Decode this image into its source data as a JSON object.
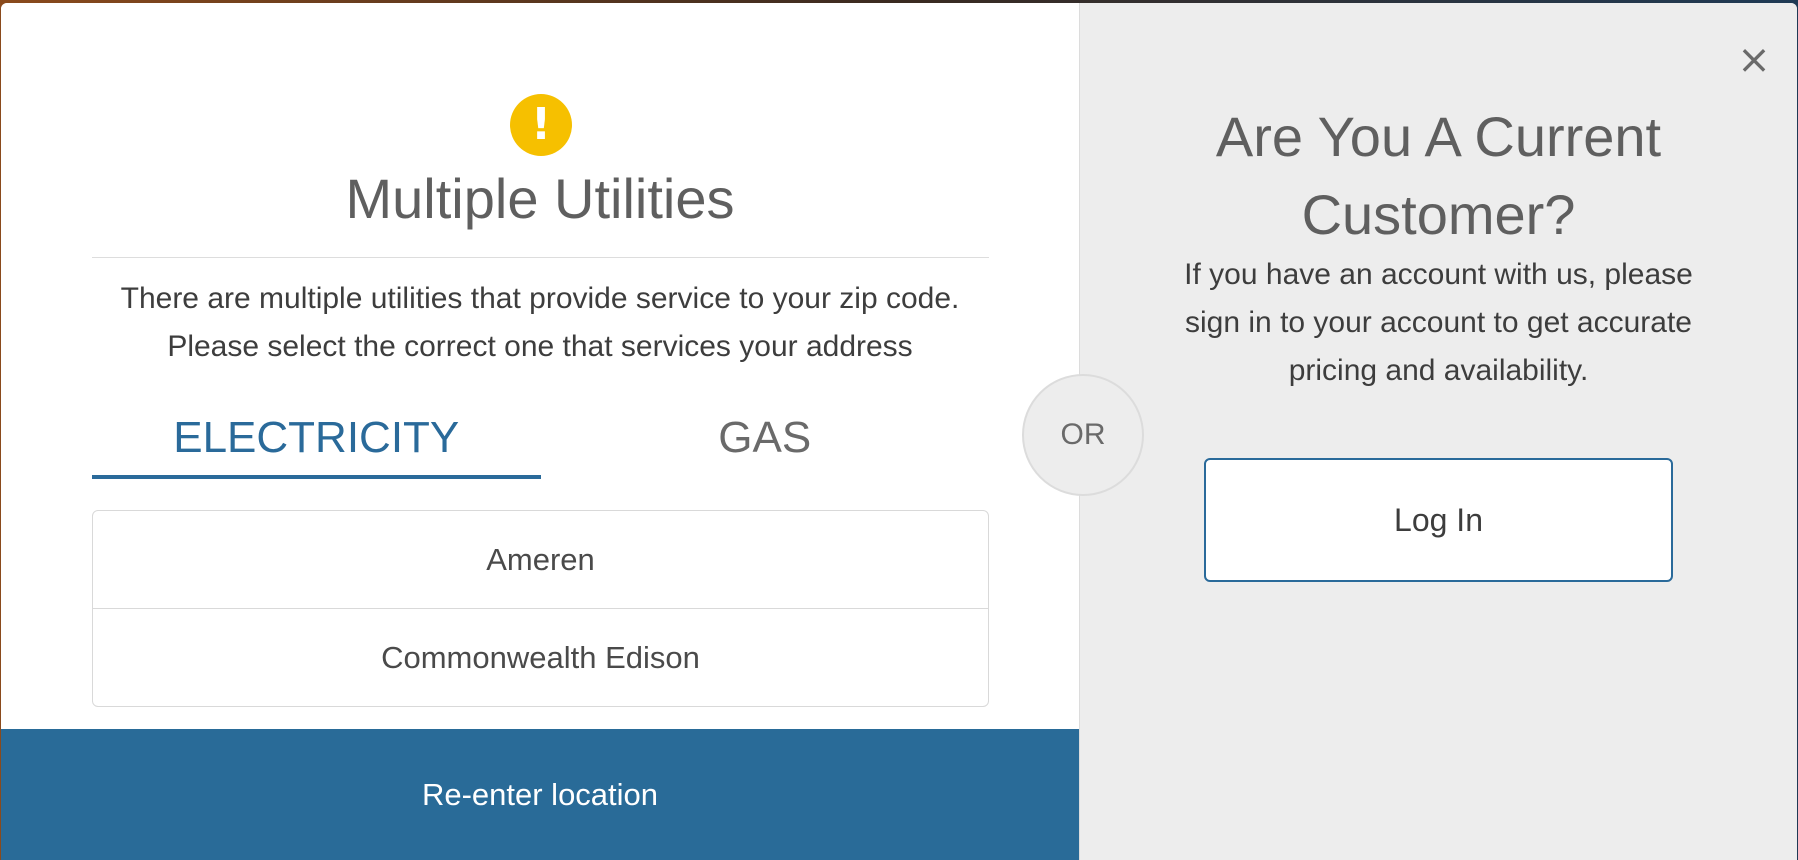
{
  "left_panel": {
    "icon": "exclamation-icon",
    "icon_glyph": "!",
    "title": "Multiple Utilities",
    "description_line1": "There are multiple utilities that provide service to your zip code.",
    "description_line2": "Please select the correct one that services your address",
    "tabs": [
      {
        "label": "ELECTRICITY",
        "active": true
      },
      {
        "label": "GAS",
        "active": false
      }
    ],
    "utilities": [
      "Ameren",
      "Commonwealth Edison"
    ],
    "reenter_label": "Re-enter location"
  },
  "or_label": "OR",
  "right_panel": {
    "close_glyph": "×",
    "title_line1": "Are You A Current",
    "title_line2": "Customer?",
    "description_line1": "If you have an account with us, please",
    "description_line2": "sign in to your account to get accurate",
    "description_line3": "pricing and availability.",
    "login_label": "Log In"
  },
  "colors": {
    "accent": "#296b98",
    "warning": "#f6c000",
    "panel_gray": "#ededed"
  }
}
